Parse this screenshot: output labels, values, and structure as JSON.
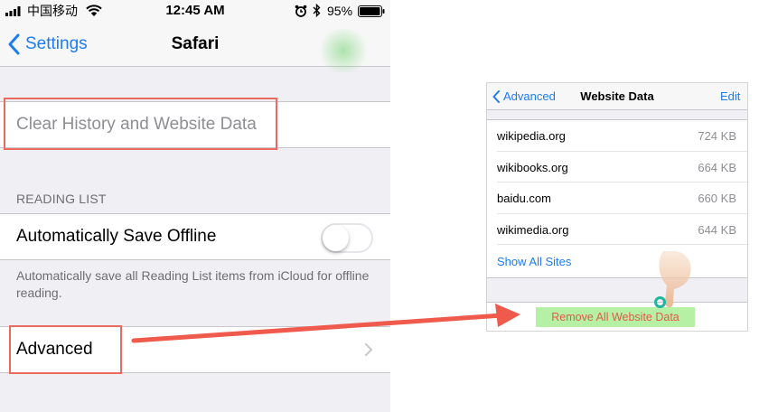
{
  "status_bar": {
    "carrier": "中国移动",
    "time": "12:45 AM",
    "battery_percent": "95%"
  },
  "nav": {
    "back_label": "Settings",
    "title": "Safari"
  },
  "settings": {
    "clear_history_label": "Clear History and Website Data",
    "reading_list_header": "READING LIST",
    "auto_save_label": "Automatically Save Offline",
    "auto_save_on": false,
    "auto_save_note": "Automatically save all Reading List items from iCloud for offline reading.",
    "advanced_label": "Advanced"
  },
  "website_data": {
    "back_label": "Advanced",
    "title": "Website Data",
    "edit_label": "Edit",
    "sites": [
      {
        "name": "wikipedia.org",
        "size": "724 KB"
      },
      {
        "name": "wikibooks.org",
        "size": "664 KB"
      },
      {
        "name": "baidu.com",
        "size": "660 KB"
      },
      {
        "name": "wikimedia.org",
        "size": "644 KB"
      }
    ],
    "show_all_label": "Show All Sites",
    "remove_all_label": "Remove All Website Data"
  },
  "colors": {
    "ios_blue": "#1e7cf2",
    "highlight_red": "#ea6a5e",
    "destructive_red": "#e35a48",
    "remove_highlight_green": "#b6f0a4"
  }
}
